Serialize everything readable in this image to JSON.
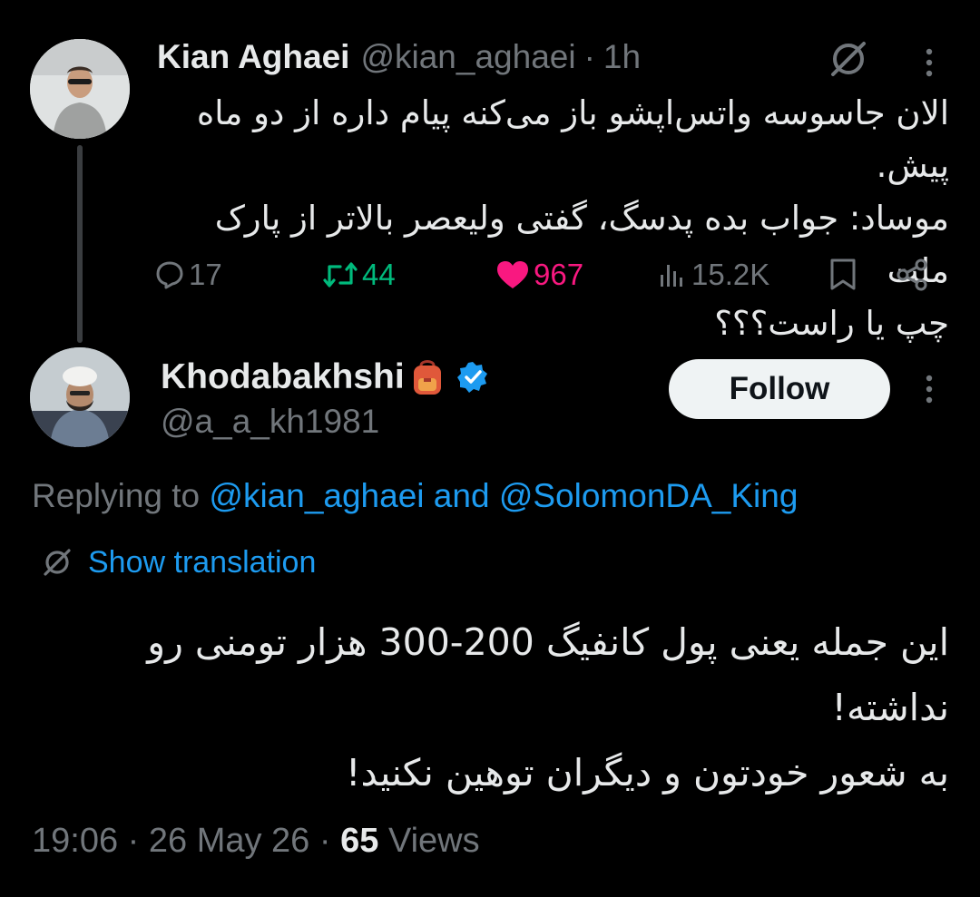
{
  "parent_tweet": {
    "author_name": "Kian Aghaei",
    "handle": "@kian_aghaei",
    "separator": "·",
    "time": "1h",
    "text": "الان جاسوسه واتس‌اپشو باز می‌کنه پیام داره از دو ماه پیش.\nموساد: جواب بده پدسگ، گفتی ولیعصر بالاتر از پارک ملت\nچپ یا راست؟؟؟",
    "replies": "17",
    "retweets": "44",
    "likes": "967",
    "views": "15.2K"
  },
  "reply_tweet": {
    "author_name": "Khodabakhshi",
    "handle": "@a_a_kh1981",
    "follow_label": "Follow",
    "replying_prefix": "Replying to ",
    "replying_user1": "@kian_aghaei",
    "replying_and": " and ",
    "replying_user2": "@SolomonDA_King",
    "translate_label": "Show translation",
    "text": "این جمله یعنی پول کانفیگ 200-300 هزار تومنی رو نداشته!\nبه شعور خودتون و دیگران توهین نکنید!",
    "time": "19:06",
    "date_sep": " · ",
    "date": "26 May 26",
    "views_sep": " · ",
    "views_count": "65",
    "views_label": " Views"
  },
  "colors": {
    "background": "#000000",
    "text": "#e7e9ea",
    "muted": "#71767b",
    "accent": "#1d9bf0",
    "retweet": "#00ba7c",
    "like": "#f91880",
    "verified": "#1d9bf0"
  },
  "icons": {
    "parent_more": "more-icon",
    "grok": "grok-icon",
    "reply": "reply-icon",
    "retweet": "retweet-icon",
    "like": "heart-filled-icon",
    "views": "views-bar-chart-icon",
    "bookmark": "bookmark-icon",
    "share": "share-icon",
    "name_badge": "backpack-emoji",
    "verified": "verified-badge-icon",
    "translate": "translate-icon"
  }
}
